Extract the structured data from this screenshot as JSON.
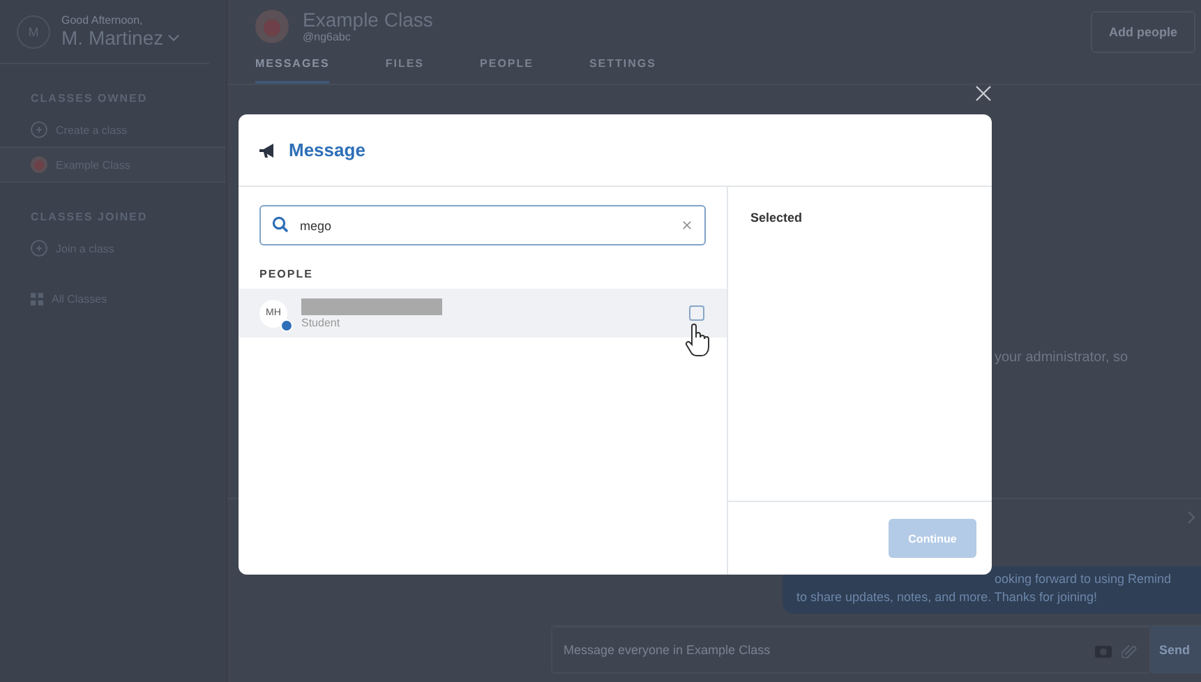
{
  "sidebar": {
    "avatar": "M",
    "greeting": "Good Afternoon,",
    "user": "M. Martinez",
    "sections": [
      {
        "heading": "CLASSES OWNED",
        "items": [
          {
            "kind": "add",
            "label": "Create a class",
            "selected": false
          },
          {
            "kind": "class",
            "label": "Example Class",
            "selected": true
          }
        ]
      },
      {
        "heading": "CLASSES JOINED",
        "items": [
          {
            "kind": "add",
            "label": "Join a class",
            "selected": false
          }
        ]
      }
    ],
    "all_classes": "All Classes"
  },
  "class_header": {
    "title": "Example Class",
    "handle": "@ng6abc",
    "tabs": [
      {
        "label": "MESSAGES",
        "selected": true
      },
      {
        "label": "FILES",
        "selected": false
      },
      {
        "label": "PEOPLE",
        "selected": false
      },
      {
        "label": "SETTINGS",
        "selected": false
      }
    ],
    "add_button": "Add people"
  },
  "feed": {
    "notice": "your administrator, so",
    "bubble_lines": [
      "ooking forward to using Remind",
      "to share updates, notes, and more. Thanks for joining!"
    ],
    "composer": {
      "placeholder": "Message everyone in Example Class",
      "send": "Send"
    }
  },
  "modal": {
    "title": "Message",
    "search": {
      "value": "mego"
    },
    "section": "PEOPLE",
    "people": [
      {
        "initials": "MH",
        "role": "Student",
        "checked": false,
        "hovered": true
      }
    ],
    "selected_heading": "Selected",
    "continue": {
      "label": "Continue",
      "disabled": true
    }
  }
}
